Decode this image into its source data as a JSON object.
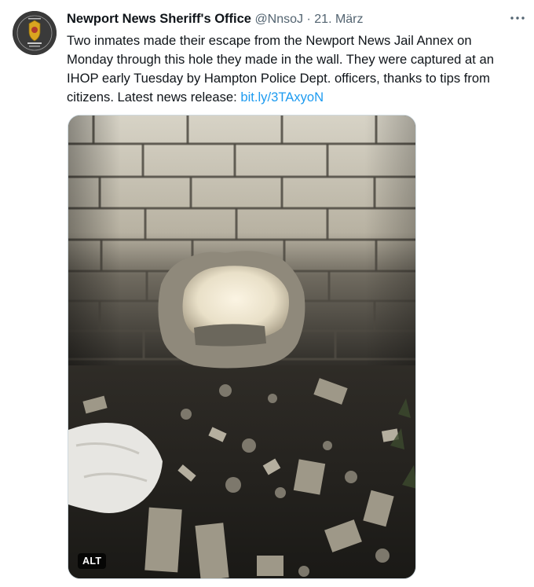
{
  "tweet": {
    "author_name": "Newport News Sheriff's Office",
    "handle": "@NnsoJ",
    "separator": "·",
    "date": "21. März",
    "text_lines": [
      "Two inmates made their escape from the Newport News Jail Annex on",
      "Monday through this hole they made in the wall. They were captured at an",
      "IHOP early Tuesday by Hampton Police Dept. officers, thanks to tips from"
    ],
    "text_last_prefix": "citizens. Latest news release: ",
    "link_text": "bit.ly/3TAxyoN",
    "media": {
      "description_icon": "photo-brick-wall-hole",
      "alt_label": "ALT"
    }
  },
  "icons": {
    "more": "more-horizontal-icon",
    "avatar": "sheriff-badge-avatar"
  },
  "colors": {
    "link": "#1d9bf0",
    "secondary_text": "#536471",
    "primary_text": "#0f1419"
  }
}
